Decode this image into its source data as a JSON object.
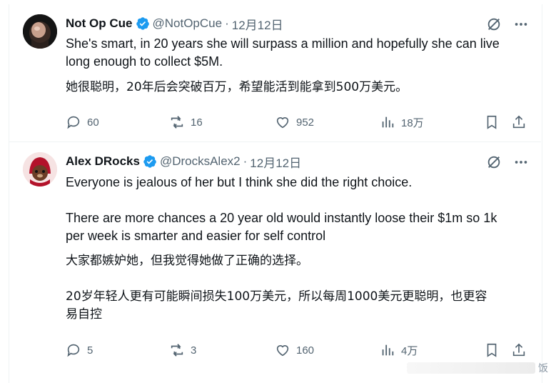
{
  "tweets": [
    {
      "name": "Not Op Cue",
      "handle": "@NotOpCue",
      "separator": "·",
      "date": "12月12日",
      "text_en_1": "She's smart, in 20 years she will surpass a million and hopefully she can live",
      "text_en_2": "long enough to collect $5M.",
      "text_zh_1": "她很聪明，20年后会突破百万，希望能活到能拿到500万美元。",
      "replies": "60",
      "reposts": "16",
      "likes": "952",
      "views": "18万"
    },
    {
      "name": "Alex DRocks",
      "handle": "@DrocksAlex2",
      "separator": "·",
      "date": "12月12日",
      "text_en_1": "Everyone is jealous of her but I think she did the right choice.",
      "text_en_2": "There are more chances a 20 year old would instantly loose their $1m so 1k",
      "text_en_3": "per week is smarter and easier for self control",
      "text_zh_1": "大家都嫉妒她，但我觉得她做了正确的选择。",
      "text_zh_2": "20岁年轻人更有可能瞬间损失100万美元，所以每周1000美元更聪明，也更容",
      "text_zh_3": "易自控",
      "replies": "5",
      "reposts": "3",
      "likes": "160",
      "views": "4万"
    }
  ],
  "watermark": "饭",
  "colors": {
    "text": "#0f1419",
    "secondary": "#536471",
    "verified": "#1d9bf0",
    "border": "#eff3f4"
  },
  "icons": [
    "verified-badge-icon",
    "grok-icon",
    "more-icon",
    "reply-icon",
    "repost-icon",
    "like-icon",
    "views-icon",
    "bookmark-icon",
    "share-icon"
  ]
}
